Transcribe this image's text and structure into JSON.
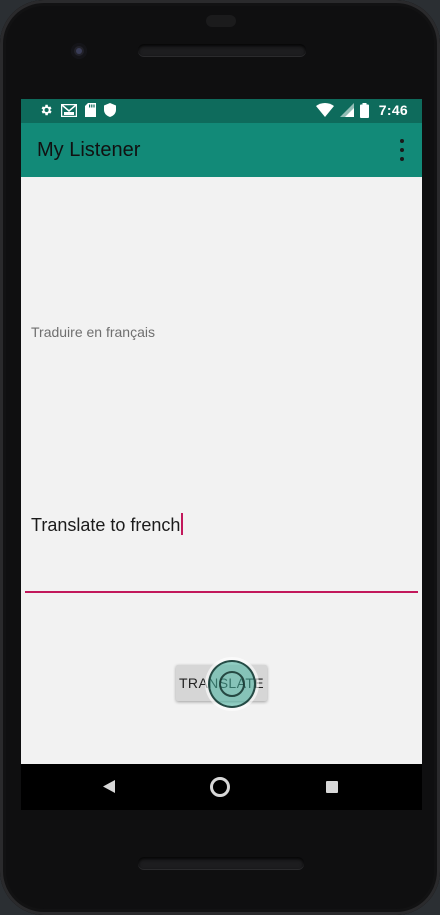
{
  "status_bar": {
    "time": "7:46",
    "left_icons": [
      "settings-icon",
      "gmail-icon",
      "sd-card-icon",
      "shield-icon"
    ],
    "right_icons": [
      "wifi-icon",
      "signal-icon",
      "battery-icon"
    ]
  },
  "app_bar": {
    "title": "My Listener",
    "overflow_icon": "more-vert-icon"
  },
  "main": {
    "hint_label": "Traduire en français",
    "input_value": "Translate to french",
    "translate_button": "TRANSLATE"
  },
  "nav_bar": {
    "icons": [
      "back-icon",
      "home-icon",
      "recent-apps-icon"
    ]
  },
  "colors": {
    "status_bar": "#0e6b5c",
    "app_bar": "#128a78",
    "accent": "#c2185b",
    "screen_bg": "#f2f2f2"
  }
}
